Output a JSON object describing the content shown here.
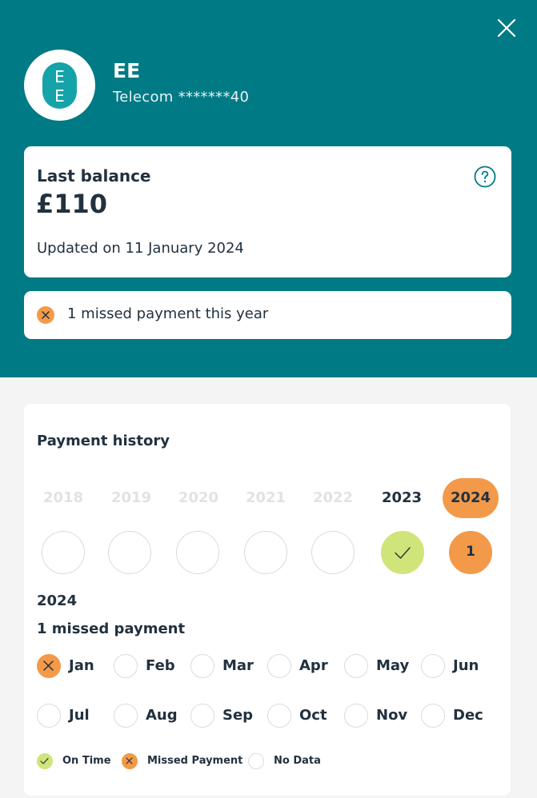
{
  "colors": {
    "header_bg": "#007a84",
    "on_time": "#cfe57a",
    "missed": "#f39a4a",
    "no_data_border": "#d8dcdf",
    "text": "#22313f"
  },
  "header": {
    "close_icon": "close-icon",
    "logo_icon": "ee-logo-icon",
    "brand_name": "EE",
    "brand_sub": "Telecom *******40"
  },
  "balance": {
    "label": "Last balance",
    "value": "£110",
    "updated": "Updated on 11 January 2024",
    "help_icon": "question-icon"
  },
  "missed_banner": {
    "icon": "missed-icon",
    "text": "1 missed payment this year"
  },
  "history": {
    "title": "Payment history",
    "years": [
      {
        "label": "2018",
        "status": "no-data"
      },
      {
        "label": "2019",
        "status": "no-data"
      },
      {
        "label": "2020",
        "status": "no-data"
      },
      {
        "label": "2021",
        "status": "no-data"
      },
      {
        "label": "2022",
        "status": "no-data"
      },
      {
        "label": "2023",
        "status": "on-time"
      },
      {
        "label": "2024",
        "status": "missed",
        "count": "1",
        "selected": true
      }
    ],
    "selected_year": "2024",
    "summary": "1 missed payment",
    "months": [
      {
        "label": "Jan",
        "status": "missed"
      },
      {
        "label": "Feb",
        "status": "no-data"
      },
      {
        "label": "Mar",
        "status": "no-data"
      },
      {
        "label": "Apr",
        "status": "no-data"
      },
      {
        "label": "May",
        "status": "no-data"
      },
      {
        "label": "Jun",
        "status": "no-data"
      },
      {
        "label": "Jul",
        "status": "no-data"
      },
      {
        "label": "Aug",
        "status": "no-data"
      },
      {
        "label": "Sep",
        "status": "no-data"
      },
      {
        "label": "Oct",
        "status": "no-data"
      },
      {
        "label": "Nov",
        "status": "no-data"
      },
      {
        "label": "Dec",
        "status": "no-data"
      }
    ],
    "legend": [
      {
        "label": "On Time",
        "status": "on-time"
      },
      {
        "label": "Missed Payment",
        "status": "missed"
      },
      {
        "label": "No Data",
        "status": "no-data"
      }
    ]
  }
}
